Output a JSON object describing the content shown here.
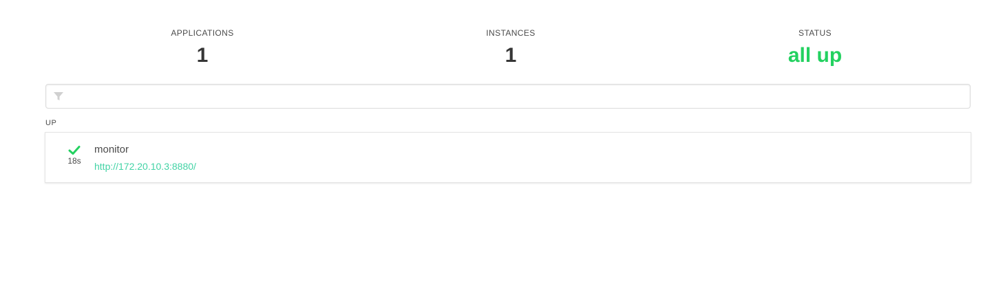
{
  "summary": {
    "applications_label": "APPLICATIONS",
    "applications_value": "1",
    "instances_label": "INSTANCES",
    "instances_value": "1",
    "status_label": "STATUS",
    "status_value": "all up",
    "status_color": "#23d160"
  },
  "filter": {
    "placeholder": "",
    "value": "",
    "icon": "filter-icon"
  },
  "groups": [
    {
      "heading": "UP",
      "instances": [
        {
          "status_icon": "check-icon",
          "since": "18s",
          "name": "monitor",
          "url": "http://172.20.10.3:8880/"
        }
      ]
    }
  ],
  "colors": {
    "up": "#23d160",
    "link": "#42d3a5"
  }
}
